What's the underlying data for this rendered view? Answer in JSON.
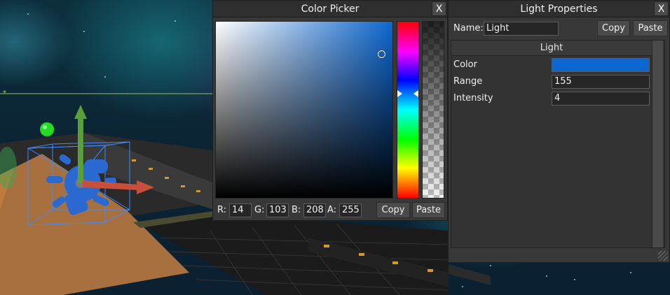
{
  "color_picker": {
    "title": "Color Picker",
    "close_label": "X",
    "r_label": "R:",
    "r_value": "14",
    "g_label": "G:",
    "g_value": "103",
    "b_label": "B:",
    "b_value": "208",
    "a_label": "A:",
    "a_value": "255",
    "copy_label": "Copy",
    "paste_label": "Paste",
    "selected_color": "#0e67d0"
  },
  "light_properties": {
    "title": "Light Properties",
    "close_label": "X",
    "name_label": "Name:",
    "name_value": "Light",
    "copy_label": "Copy",
    "paste_label": "Paste",
    "section_title": "Light",
    "color_label": "Color",
    "color_value": "#0e67d0",
    "range_label": "Range",
    "range_value": "155",
    "intensity_label": "Intensity",
    "intensity_value": "4"
  },
  "icons": {
    "light_gizmo": "light-bulb-icon",
    "translate_y": "arrow-up-icon",
    "translate_x": "arrow-right-icon"
  },
  "colors": {
    "gizmo_blue": "#2a6ad0",
    "axis_y": "#5aa03a",
    "axis_x": "#c8503a",
    "sphere": "#22dd22"
  }
}
